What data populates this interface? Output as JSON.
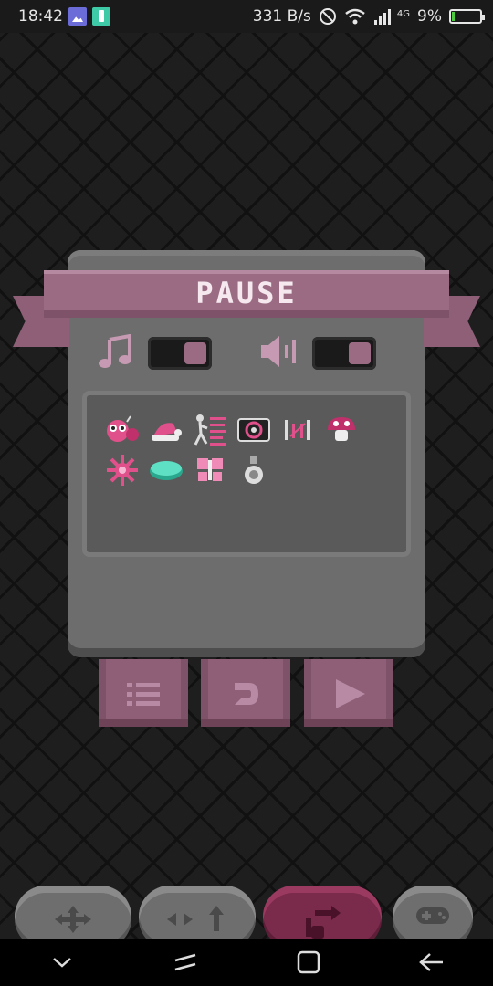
{
  "status_bar": {
    "time": "18:42",
    "net_speed": "331 B/s",
    "network_type": "4G",
    "battery_percent": "9%",
    "battery_level": 0.09,
    "icons": [
      "gallery-icon",
      "battery-saver-icon",
      "do-not-disturb-icon",
      "wifi-icon",
      "signal-icon"
    ]
  },
  "pause_menu": {
    "title": "PAUSE",
    "music_toggle": {
      "icon": "music-note-icon",
      "state": "on"
    },
    "sound_toggle": {
      "icon": "speaker-icon",
      "state": "on"
    },
    "inventory_items": [
      "bug-creature-icon",
      "santa-hat-icon",
      "running-skeleton-icon",
      "speaker-box-icon",
      "gate-icon",
      "mushroom-icon",
      "sun-icon",
      "teal-disc-icon",
      "butterfly-icon",
      "potion-bottle-icon"
    ],
    "buttons": [
      "menu-list-icon",
      "restart-icon",
      "play-icon"
    ]
  },
  "bottom_controls": [
    "dpad-arrows-icon",
    "arrows-left-right-up-icon",
    "tap-arrow-icon",
    "gamepad-icon"
  ],
  "colors": {
    "accent_pink": "#9a6b82",
    "panel_gray": "#6d6d6d",
    "active_control": "#7a2a4a"
  }
}
